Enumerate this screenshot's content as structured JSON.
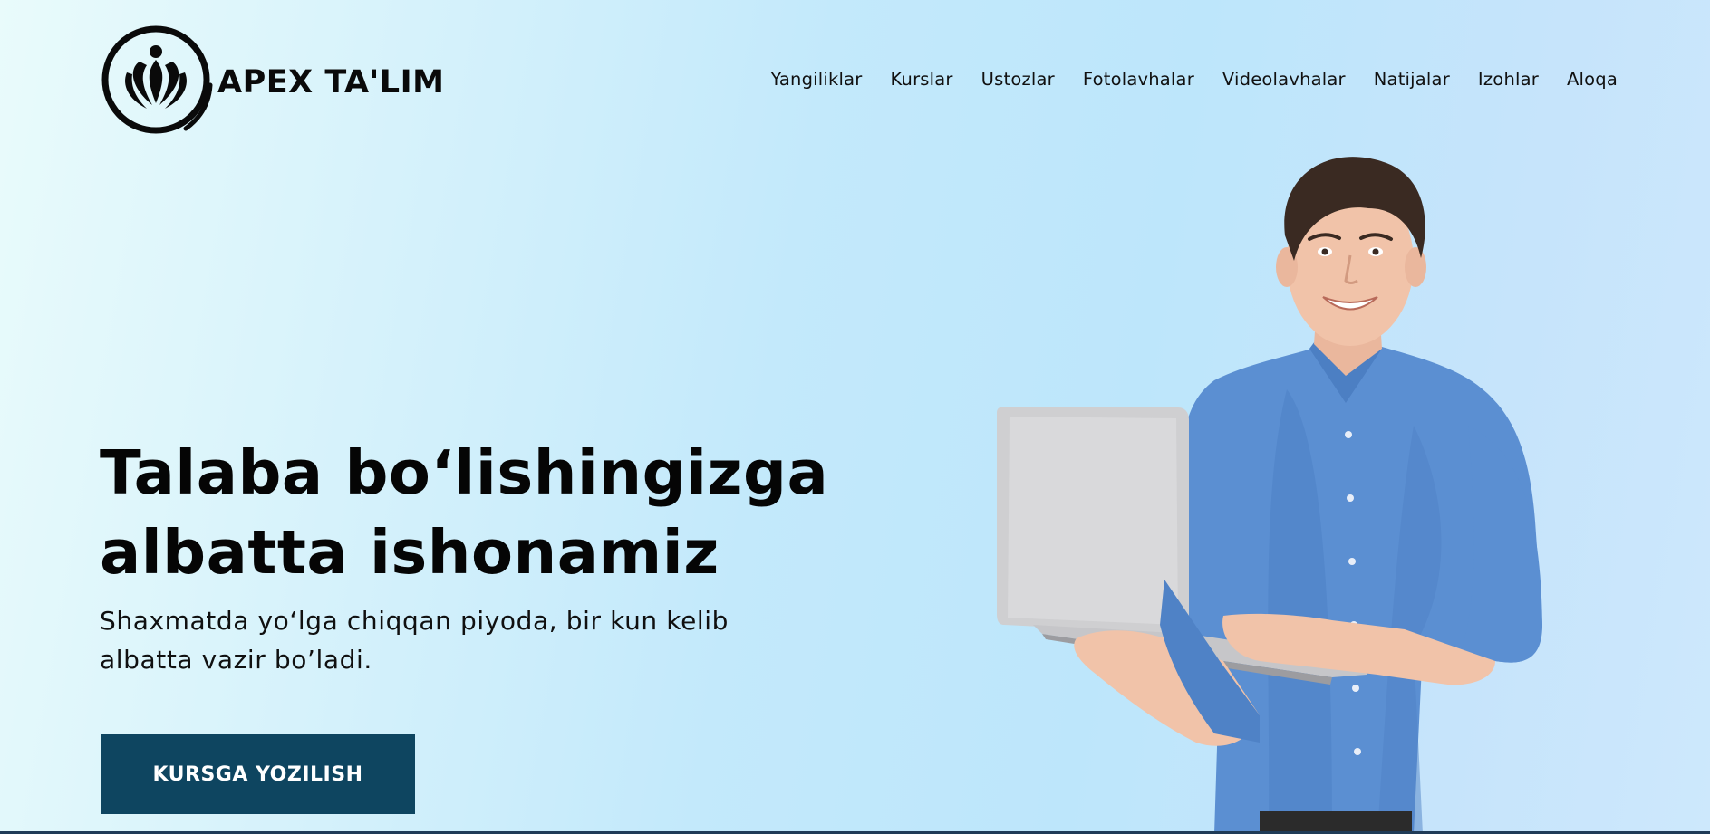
{
  "header": {
    "brand": "APEX TA'LIM",
    "logo_icon": "apex-ring-logo",
    "nav": [
      "Yangiliklar",
      "Kurslar",
      "Ustozlar",
      "Fotolavhalar",
      "Videolavhalar",
      "Natijalar",
      "Izohlar",
      "Aloqa"
    ]
  },
  "hero": {
    "title_line1": "Talaba bo‘lishingizga",
    "title_line2": "albatta ishonamiz",
    "subtitle_line1": "Shaxmatda yo‘lga chiqqan piyoda, bir kun kelib",
    "subtitle_line2": "albatta vazir bo’ladi.",
    "cta_label": "KURSGA YOZILISH"
  },
  "colors": {
    "cta_background": "#0e4560",
    "text": "#0a0a0a",
    "shirt": "#5a8fd0"
  }
}
